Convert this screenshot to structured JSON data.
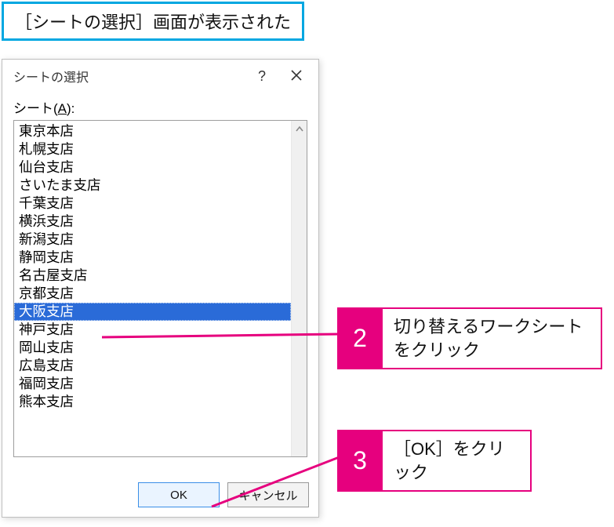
{
  "header": {
    "caption": "［シートの選択］画面が表示された"
  },
  "dialog": {
    "title": "シートの選択",
    "help_label": "?",
    "listbox_label_prefix": "シート(",
    "listbox_label_accel": "A",
    "listbox_label_suffix": "):",
    "items": [
      "東京本店",
      "札幌支店",
      "仙台支店",
      "さいたま支店",
      "千葉支店",
      "横浜支店",
      "新潟支店",
      "静岡支店",
      "名古屋支店",
      "京都支店",
      "大阪支店",
      "神戸支店",
      "岡山支店",
      "広島支店",
      "福岡支店",
      "熊本支店"
    ],
    "selected_index": 10,
    "ok_label": "OK",
    "cancel_label": "キャンセル"
  },
  "callouts": {
    "c2": {
      "num": "2",
      "text": "切り替えるワークシートをクリック"
    },
    "c3": {
      "num": "3",
      "text": "［OK］をクリック"
    }
  },
  "colors": {
    "accent_blue": "#00A7E1",
    "callout_pink": "#E6007E",
    "selection_blue": "#2a6bd8"
  }
}
